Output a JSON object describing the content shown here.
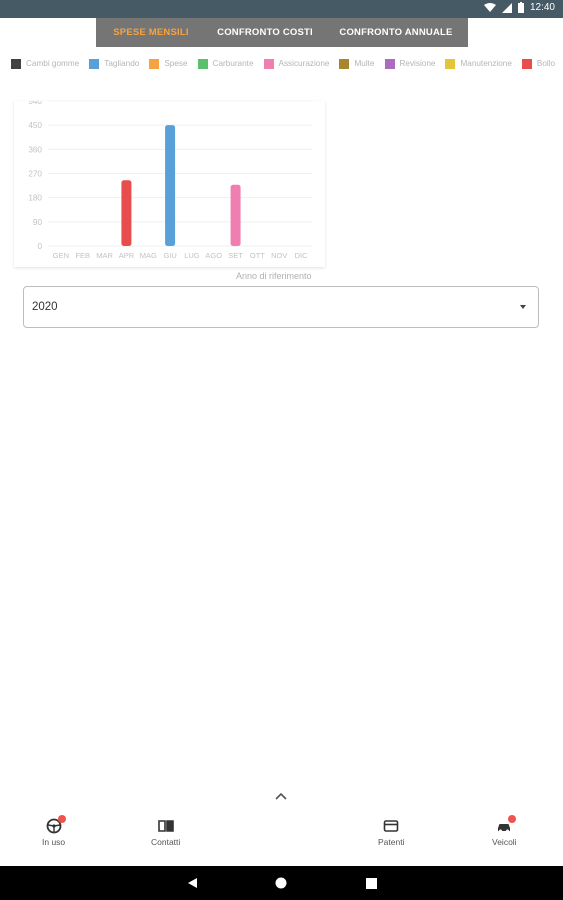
{
  "status_bar": {
    "time": "12:40",
    "icons": [
      "wifi-icon",
      "signal-icon",
      "battery-icon"
    ]
  },
  "tabs": [
    {
      "label": "SPESE MENSILI",
      "active": true
    },
    {
      "label": "CONFRONTO COSTI",
      "active": false
    },
    {
      "label": "CONFRONTO ANNUALE",
      "active": false
    }
  ],
  "legend": [
    {
      "label": "Cambi gomme",
      "color": "#424242"
    },
    {
      "label": "Tagliando",
      "color": "#5aa0d8"
    },
    {
      "label": "Spese",
      "color": "#f7a240"
    },
    {
      "label": "Carburante",
      "color": "#5cbf6b"
    },
    {
      "label": "Assicurazione",
      "color": "#ef7fb0"
    },
    {
      "label": "Multe",
      "color": "#a8862e"
    },
    {
      "label": "Revisione",
      "color": "#ab6cc0"
    },
    {
      "label": "Manutenzione",
      "color": "#e3c53a"
    },
    {
      "label": "Bollo",
      "color": "#e84c4c"
    }
  ],
  "chart_data": {
    "type": "bar",
    "categories": [
      "GEN",
      "FEB",
      "MAR",
      "APR",
      "MAG",
      "GIU",
      "LUG",
      "AGO",
      "SET",
      "OTT",
      "NOV",
      "DIC"
    ],
    "yticks": [
      0,
      90,
      180,
      270,
      360,
      450,
      540
    ],
    "ylim": [
      0,
      540
    ],
    "xlabel": "Anno di riferimento",
    "bars": [
      {
        "category": "APR",
        "value": 245,
        "color": "#e84c4c"
      },
      {
        "category": "GIU",
        "value": 450,
        "color": "#5aa0d8"
      },
      {
        "category": "SET",
        "value": 228,
        "color": "#ef7fb0"
      }
    ],
    "grid": true
  },
  "year_select": {
    "value": "2020"
  },
  "bottom_nav": [
    {
      "label": "In uso",
      "icon": "steering-wheel-icon",
      "badge": true
    },
    {
      "label": "Contatti",
      "icon": "contacts-book-icon",
      "badge": false
    },
    {
      "label": "Patenti",
      "icon": "license-card-icon",
      "badge": false
    },
    {
      "label": "Veicoli",
      "icon": "car-icon",
      "badge": true
    }
  ]
}
